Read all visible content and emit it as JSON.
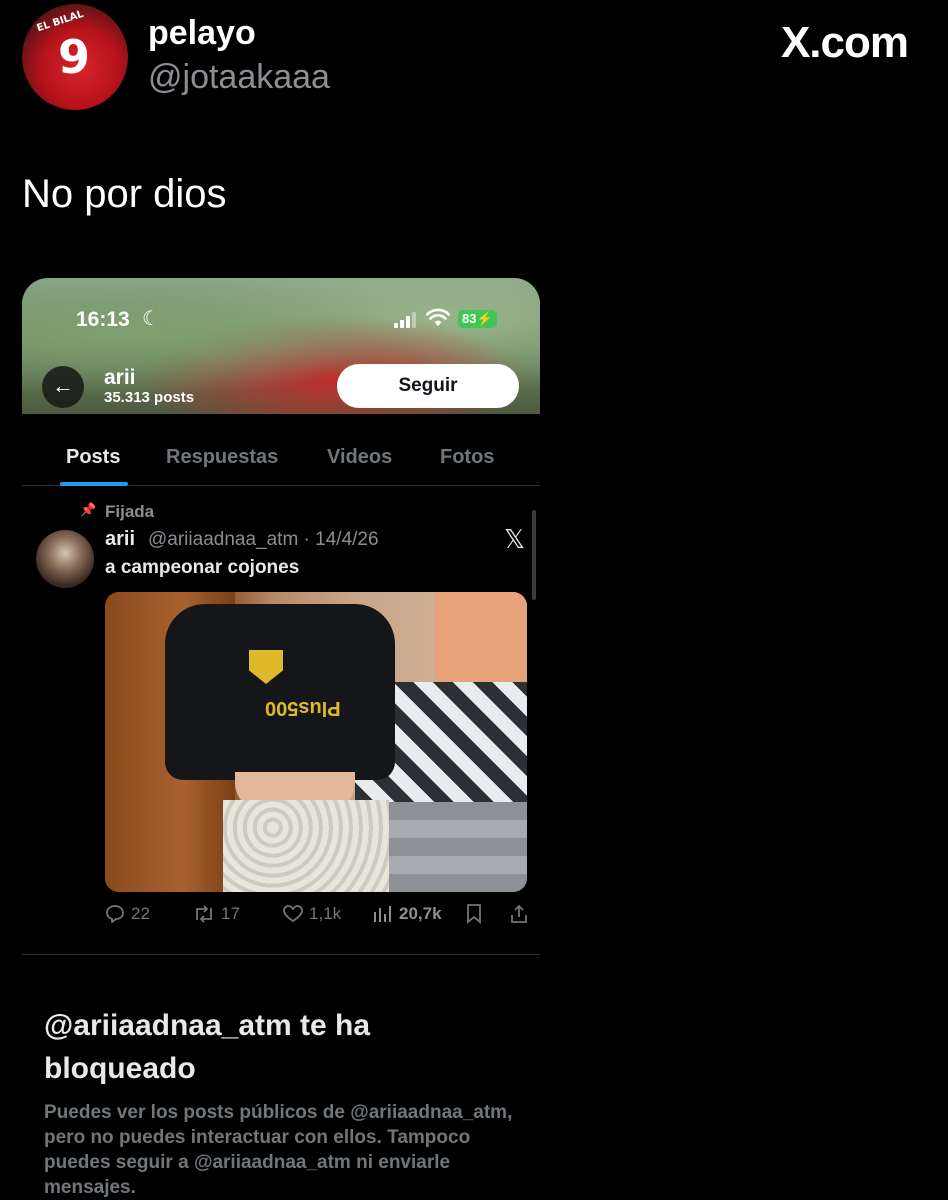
{
  "tweet": {
    "display_name": "pelayo",
    "handle": "@jotaakaaa",
    "brand": "X.com",
    "text": "No por dios",
    "avatar_jersey_text": "EL BILAL",
    "avatar_jersey_number": "9"
  },
  "screenshot": {
    "status_bar": {
      "time": "16:13",
      "battery": "83"
    },
    "profile": {
      "name": "arii",
      "posts_count": "35.313 posts",
      "follow_label": "Seguir"
    },
    "tabs": [
      {
        "label": "Posts",
        "active": true
      },
      {
        "label": "Respuestas",
        "active": false
      },
      {
        "label": "Videos",
        "active": false
      },
      {
        "label": "Fotos",
        "active": false
      }
    ],
    "pinned_post": {
      "pinned_label": "Fijada",
      "author": "arii",
      "meta": "@ariiaadnaa_atm · 14/4/26",
      "text": "a campeonar cojones",
      "photo_sponsor_text": "Plus500",
      "actions": {
        "replies": "22",
        "reposts": "17",
        "likes": "1,1k",
        "views": "20,7k"
      }
    },
    "blocked": {
      "title": "@ariiaadnaa_atm te ha bloqueado",
      "description": "Puedes ver los posts públicos de @ariiaadnaa_atm, pero no puedes interactuar con ellos. Tampoco puedes seguir a @ariiaadnaa_atm ni enviarle mensajes."
    }
  },
  "colors": {
    "background": "#000000",
    "accent_blue": "#1d9bf0",
    "muted_text": "#71767b",
    "battery_green": "#3fc751"
  }
}
